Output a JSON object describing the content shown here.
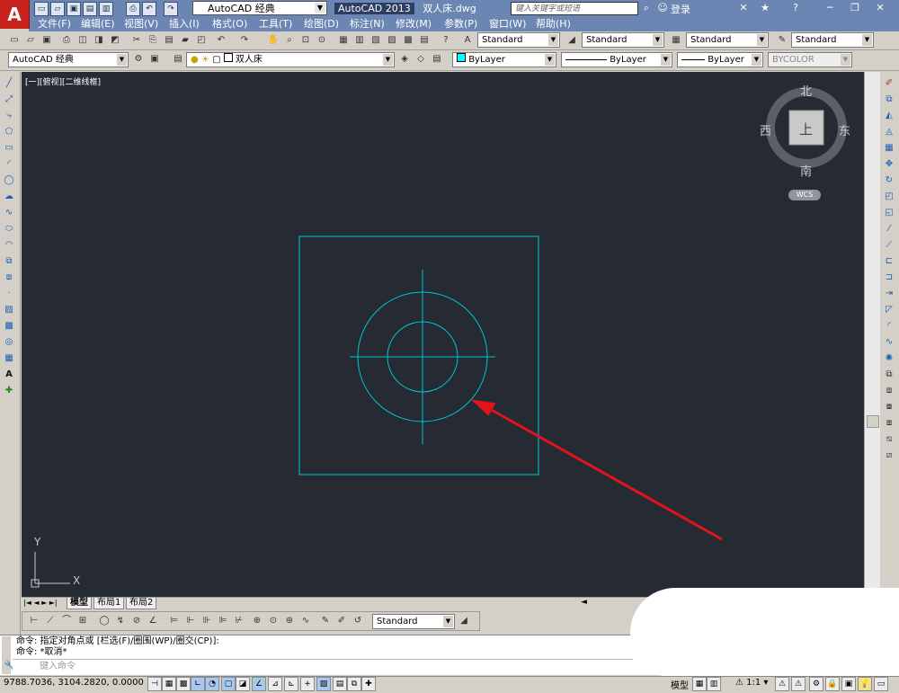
{
  "app": {
    "logo_letter": "A",
    "title_app": "AutoCAD 2013",
    "title_file": "双人床.dwg",
    "workspace": "AutoCAD 经典",
    "search_placeholder": "键入关键字或短语",
    "login": "登录"
  },
  "menu": [
    "文件(F)",
    "编辑(E)",
    "视图(V)",
    "插入(I)",
    "格式(O)",
    "工具(T)",
    "绘图(D)",
    "标注(N)",
    "修改(M)",
    "参数(P)",
    "窗口(W)",
    "帮助(H)"
  ],
  "toolbar_styles": {
    "text_style": "Standard",
    "dim_style": "Standard",
    "table_style": "Standard",
    "mleader_style": "Standard"
  },
  "layer_bar": {
    "workspace": "AutoCAD 经典",
    "layer": "双人床",
    "color": "ByLayer",
    "linetype": "ByLayer",
    "lineweight": "ByLayer",
    "plotstyle": "BYCOLOR"
  },
  "viewport": {
    "label": "[一][俯视][二维线框]",
    "viewcube": {
      "north": "北",
      "south": "南",
      "east": "东",
      "west": "西",
      "face": "上",
      "wcs": "WCS"
    },
    "ucs": {
      "x": "X",
      "y": "Y"
    }
  },
  "tabs": [
    "模型",
    "布局1",
    "布局2"
  ],
  "dim_toolbar": {
    "style": "Standard"
  },
  "command": {
    "history": [
      "命令: 指定对角点或 [栏选(F)/圈围(WP)/圈交(CP)]:",
      "命令: *取消*"
    ],
    "input_placeholder": "键入命令"
  },
  "status": {
    "coords": "9788.7036, 3104.2820, 0.0000",
    "model_label": "模型",
    "scale": "1:1"
  },
  "colors": {
    "canvas": "#252a33",
    "geometry": "#00c8d0",
    "arrow": "#e0141a"
  }
}
